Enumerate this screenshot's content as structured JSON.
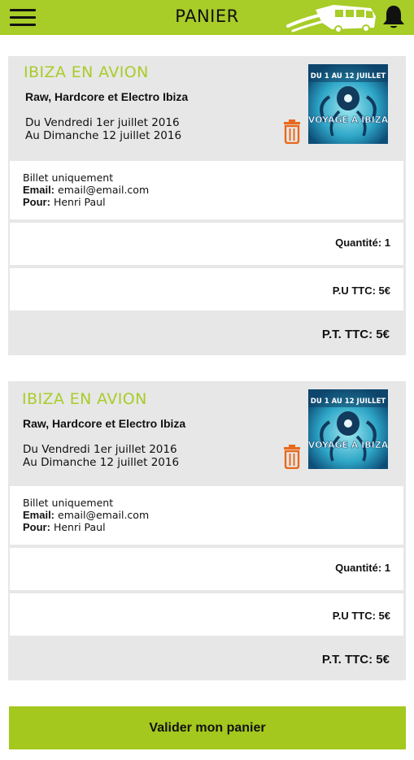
{
  "header": {
    "title": "PANIER",
    "menu_icon": "hamburger-icon",
    "logo_icon": "bus-logo-icon",
    "bell_icon": "bell-icon",
    "accent_color": "#a8cc28"
  },
  "items": [
    {
      "title": "IBIZA EN AVION",
      "subtitle": "Raw, Hardcore et Electro Ibiza",
      "date_from": "Du Vendredi 1er juillet 2016",
      "date_to": "Au Dimanche 12 juillet 2016",
      "thumb_top": "DU 1 AU 12 JUILLET",
      "thumb_main": "VOYAGE A IBIZA",
      "ticket_type": "Billet uniquement",
      "email_label": "Email:",
      "email": "email@email.com",
      "for_label": "Pour:",
      "for_name": "Henri Paul",
      "quantity": "Quantité: 1",
      "unit_price": "P.U TTC: 5€",
      "total_price": "P.T. TTC: 5€"
    },
    {
      "title": "IBIZA EN AVION",
      "subtitle": "Raw, Hardcore et Electro Ibiza",
      "date_from": "Du Vendredi 1er juillet 2016",
      "date_to": "Au Dimanche 12 juillet 2016",
      "thumb_top": "DU 1 AU 12 JUILLET",
      "thumb_main": "VOYAGE A IBIZA",
      "ticket_type": "Billet uniquement",
      "email_label": "Email:",
      "email": "email@email.com",
      "for_label": "Pour:",
      "for_name": "Henri Paul",
      "quantity": "Quantité: 1",
      "unit_price": "P.U TTC: 5€",
      "total_price": "P.T. TTC: 5€"
    }
  ],
  "footer": {
    "validate_label": "Valider mon panier"
  }
}
